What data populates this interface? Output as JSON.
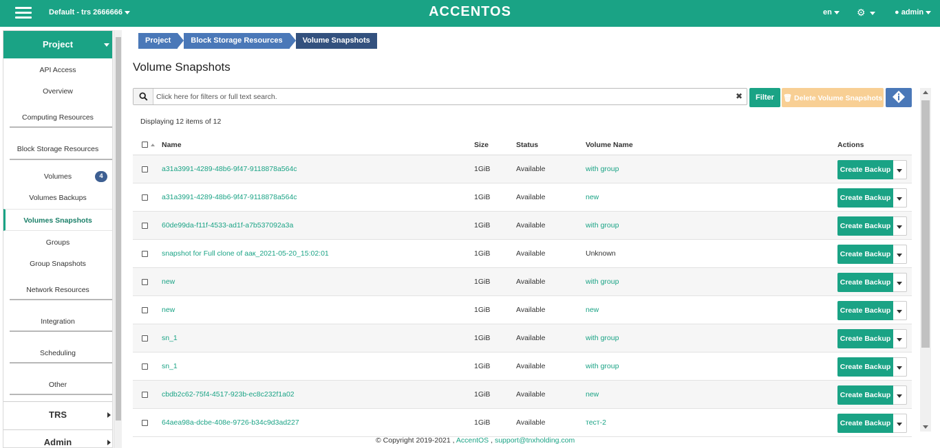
{
  "topbar": {
    "project": "Default - trs 2666666",
    "brand": "ACCENTOS",
    "language": "en",
    "user": "admin"
  },
  "sidebar": {
    "project_label": "Project",
    "items": {
      "api_access": "API Access",
      "overview": "Overview",
      "computing": "Computing Resources",
      "block_storage": "Block Storage Resources",
      "volumes": "Volumes",
      "volumes_badge": "4",
      "volumes_backups": "Volumes Backups",
      "volumes_snapshots": "Volumes Snapshots",
      "groups": "Groups",
      "group_snapshots": "Group Snapshots",
      "network": "Network Resources",
      "integration": "Integration",
      "scheduling": "Scheduling",
      "other": "Other"
    },
    "trs_label": "TRS",
    "admin_label": "Admin"
  },
  "breadcrumb": [
    "Project",
    "Block Storage Resources",
    "Volume Snapshots"
  ],
  "page_title": "Volume Snapshots",
  "search": {
    "placeholder": "Click here for filters or full text search.",
    "value": ""
  },
  "buttons": {
    "filter": "Filter",
    "delete": "Delete Volume Snapshots"
  },
  "displaying": "Displaying 12 items of 12",
  "table": {
    "headers": {
      "name": "Name",
      "size": "Size",
      "status": "Status",
      "volume": "Volume Name",
      "actions": "Actions"
    },
    "action_label": "Create Backup",
    "rows": [
      {
        "name": "a31a3991-4289-48b6-9f47-9118878a564c",
        "size": "1GiB",
        "status": "Available",
        "volume": "with group",
        "volume_link": true
      },
      {
        "name": "a31a3991-4289-48b6-9f47-9118878a564c",
        "size": "1GiB",
        "status": "Available",
        "volume": "new",
        "volume_link": true
      },
      {
        "name": "60de99da-f11f-4533-ad1f-a7b537092a3a",
        "size": "1GiB",
        "status": "Available",
        "volume": "with group",
        "volume_link": true
      },
      {
        "name": "snapshot for Full clone of аак_2021-05-20_15:02:01",
        "size": "1GiB",
        "status": "Available",
        "volume": "Unknown",
        "volume_link": false
      },
      {
        "name": "new",
        "size": "1GiB",
        "status": "Available",
        "volume": "with group",
        "volume_link": true
      },
      {
        "name": "new",
        "size": "1GiB",
        "status": "Available",
        "volume": "new",
        "volume_link": true
      },
      {
        "name": "sn_1",
        "size": "1GiB",
        "status": "Available",
        "volume": "with group",
        "volume_link": true
      },
      {
        "name": "sn_1",
        "size": "1GiB",
        "status": "Available",
        "volume": "with group",
        "volume_link": true
      },
      {
        "name": "cbdb2c62-75f4-4517-923b-ec8c232f1a02",
        "size": "1GiB",
        "status": "Available",
        "volume": "new",
        "volume_link": true
      },
      {
        "name": "64aea98a-dcbe-408e-9726-b34c9d3ad227",
        "size": "1GiB",
        "status": "Available",
        "volume": "тест-2",
        "volume_link": true
      }
    ]
  },
  "footer": {
    "copyright": "© Copyright 2019-2021 ,",
    "brand_link": "AccentOS",
    "separator": ",",
    "email": "support@tnxholding.com"
  },
  "colors": {
    "accent": "#1aa385",
    "breadcrumb": "#4a78b8",
    "breadcrumb_active": "#33517e",
    "delete_disabled": "#f8cf94"
  }
}
